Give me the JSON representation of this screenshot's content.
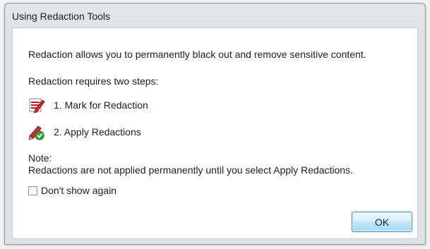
{
  "window": {
    "title": "Using Redaction Tools"
  },
  "content": {
    "intro": "Redaction allows you to permanently black out and remove sensitive content.",
    "steps_heading": "Redaction requires two steps:",
    "steps": [
      {
        "label": "1. Mark for Redaction",
        "icon": "mark-redaction-icon"
      },
      {
        "label": "2. Apply Redactions",
        "icon": "apply-redactions-icon"
      }
    ],
    "note_title": "Note:",
    "note_text": "Redactions are not applied permanently until you select Apply Redactions."
  },
  "checkbox": {
    "label": "Don't show again",
    "checked": false
  },
  "buttons": {
    "ok": "OK"
  },
  "colors": {
    "ok_button_border": "#3c7fb1",
    "ok_button_fill": "#bee6fd",
    "window_frame": "#dfe3e8",
    "icon_red": "#c8102e",
    "icon_green": "#3aa13a"
  }
}
